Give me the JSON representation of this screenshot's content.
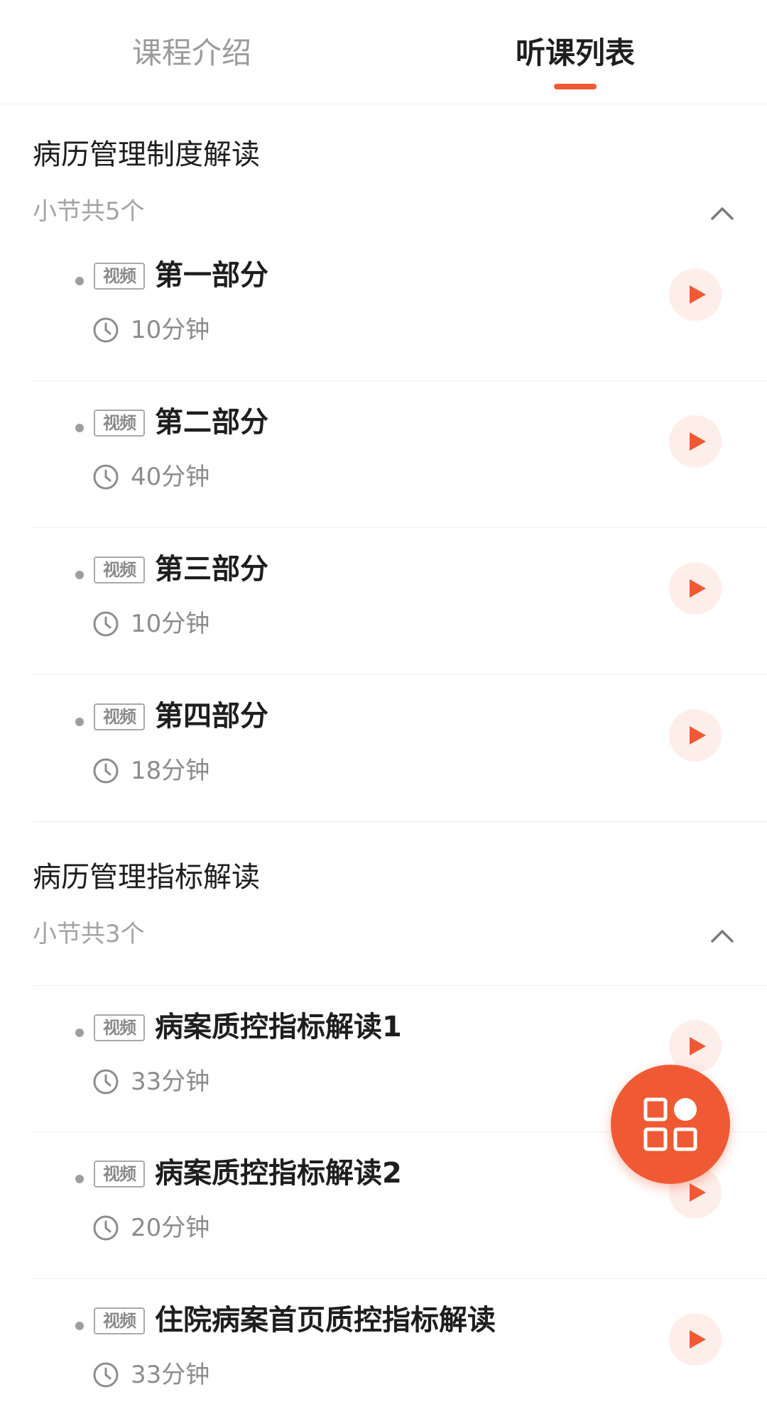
{
  "tabs": {
    "intro_label": "课程介绍",
    "list_label": "听课列表",
    "active": "听课列表"
  },
  "colors": {
    "accent": "#ef5a34",
    "play_bg": "#fdeee9"
  },
  "sections": [
    {
      "title": "病历管理制度解读",
      "count_label": "小节共5个",
      "expanded": true,
      "items": [
        {
          "tag": "视频",
          "title": "第一部分",
          "duration": "10分钟"
        },
        {
          "tag": "视频",
          "title": "第二部分",
          "duration": "40分钟"
        },
        {
          "tag": "视频",
          "title": "第三部分",
          "duration": "10分钟"
        },
        {
          "tag": "视频",
          "title": "第四部分",
          "duration": "18分钟"
        }
      ]
    },
    {
      "title": "病历管理指标解读",
      "count_label": "小节共3个",
      "expanded": true,
      "items": [
        {
          "tag": "视频",
          "title": "病案质控指标解读1",
          "duration": "33分钟"
        },
        {
          "tag": "视频",
          "title": "病案质控指标解读2",
          "duration": "20分钟"
        },
        {
          "tag": "视频",
          "title": "住院病案首页质控指标解读",
          "duration": "33分钟"
        }
      ]
    }
  ],
  "icons": {
    "chevron": "chevron-up-icon",
    "clock": "clock-icon",
    "play": "play-icon",
    "fab": "grid-menu-icon"
  }
}
